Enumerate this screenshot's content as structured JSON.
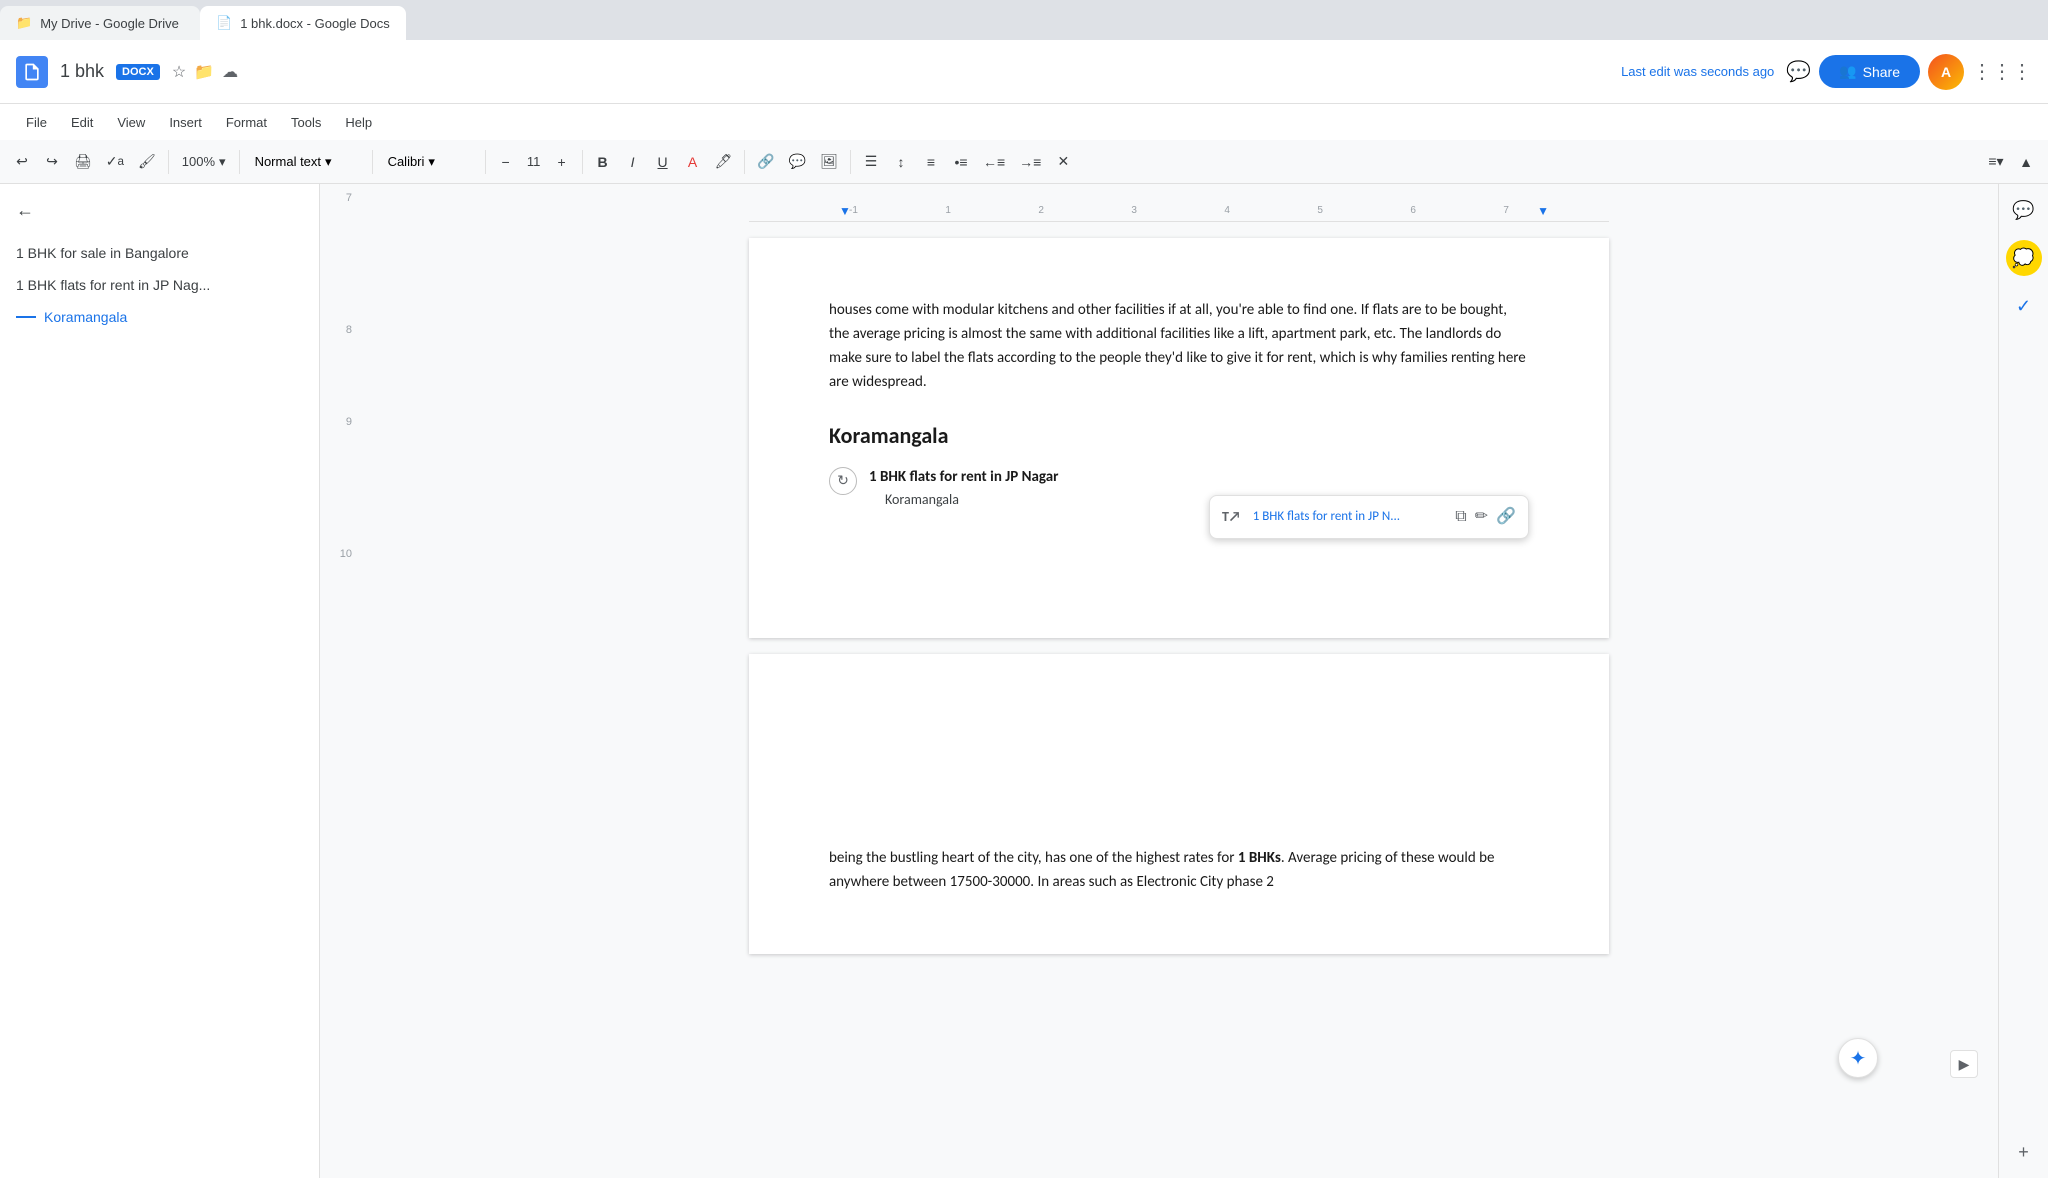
{
  "browser": {
    "tab1": {
      "label": "My Drive - Google Drive",
      "icon": "📁"
    },
    "tab2": {
      "label": "1 bhk.docx - Google Docs",
      "icon": "📄",
      "active": true
    }
  },
  "header": {
    "logo_letter": "D",
    "doc_title": "1 bhk",
    "doc_badge": "DOCX",
    "last_edit": "Last edit was seconds ago",
    "share_label": "Share"
  },
  "menu": {
    "items": [
      "File",
      "Edit",
      "View",
      "Insert",
      "Format",
      "Tools",
      "Help"
    ]
  },
  "toolbar": {
    "zoom": "100%",
    "text_style": "Normal text",
    "font": "Calibri",
    "font_size": "11",
    "bold": "B",
    "italic": "I",
    "underline": "U"
  },
  "sidebar": {
    "items": [
      {
        "label": "1 BHK for sale in Bangalore",
        "active": false
      },
      {
        "label": "1 BHK flats for rent in JP Nag...",
        "active": false
      },
      {
        "label": "Koramangala",
        "active": true
      }
    ]
  },
  "document": {
    "page1": {
      "intro_text": "houses come with modular kitchens and other facilities if at all, you're able to find one. If flats are to be bought, the average pricing is almost the same with additional facilities like a lift, apartment park, etc. The landlords do make sure to label the flats according to the people they'd like to give it for rent, which is why families renting here are widespread.",
      "heading": "Koramangala",
      "link_title": "1 BHK flats for rent in JP Nagar",
      "link_subtitle": "Koramangala",
      "tooltip_text": "1 BHK flats for rent in JP N...",
      "tooltip_full": "1 BHK flats for rent in JP N..."
    },
    "page2": {
      "bottom_text_start": "being the bustling heart of the city, has one of the highest rates for ",
      "bottom_text_bold": "1 BHKs",
      "bottom_text_end": ". Average pricing of these would be anywhere between 17500-30000. In areas such as Electronic City phase 2"
    }
  },
  "line_numbers": [
    "7",
    "8",
    "9",
    "10"
  ],
  "ruler_marks": [
    "-1",
    "1",
    "2",
    "3",
    "4",
    "5",
    "6",
    "7"
  ],
  "right_panel": {
    "icons": [
      "comment",
      "chat",
      "check",
      "add"
    ]
  }
}
